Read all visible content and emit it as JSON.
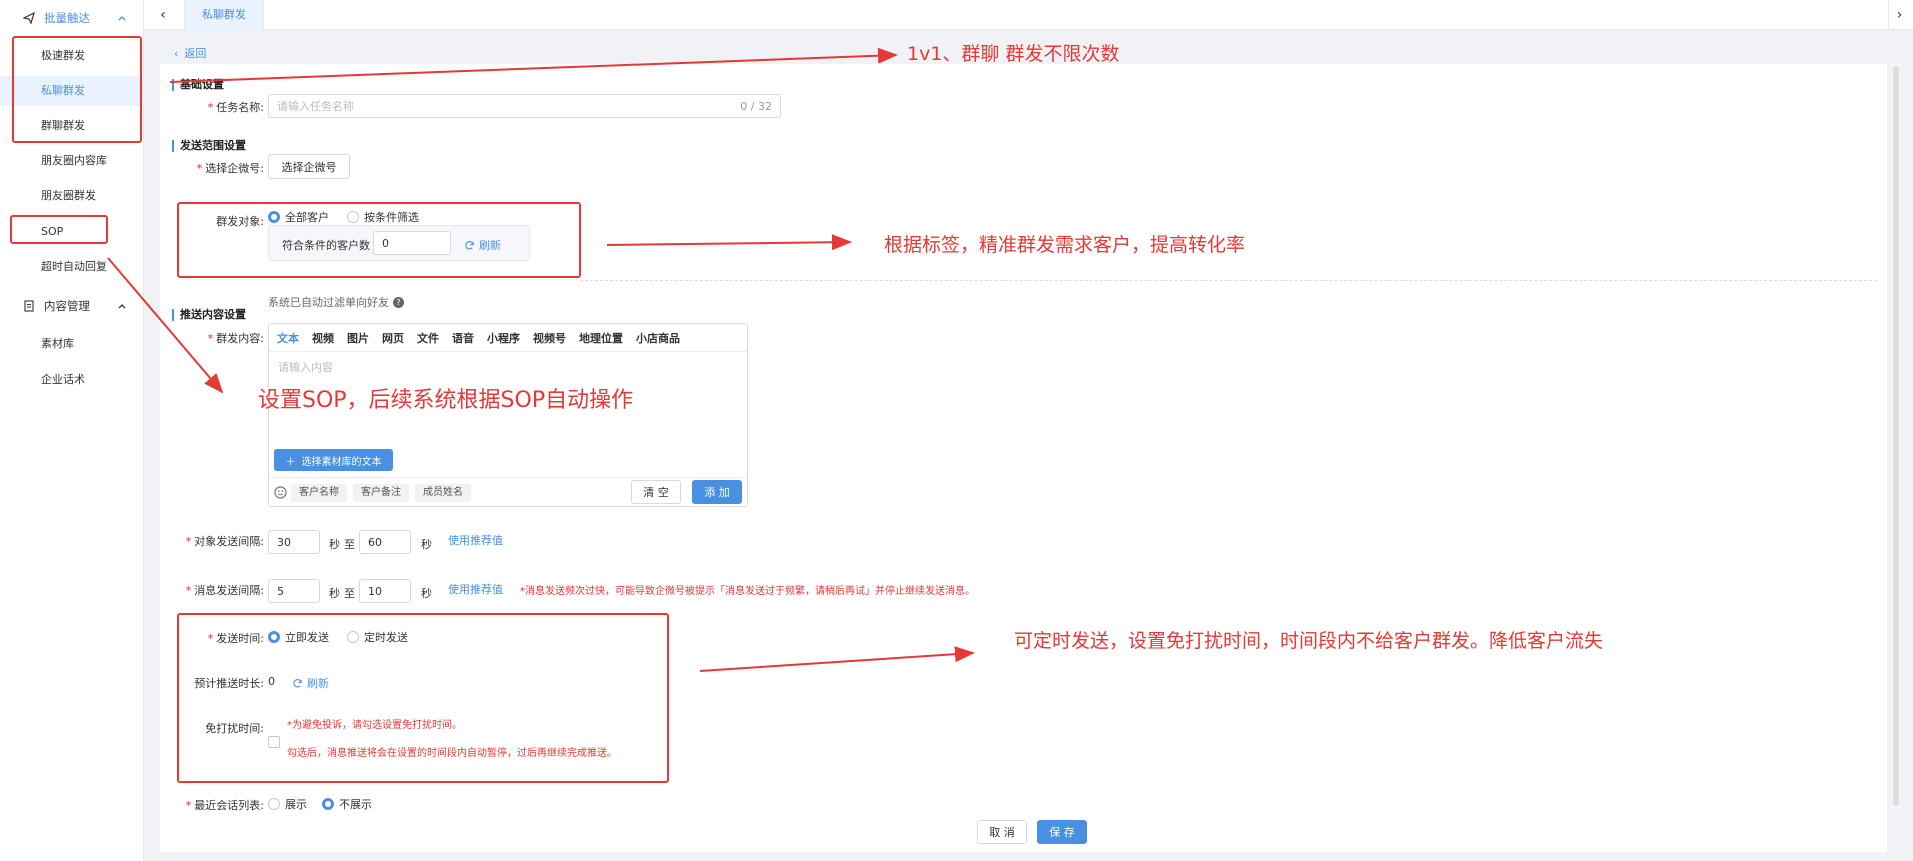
{
  "sidebar": {
    "group1": "批量触达",
    "items": [
      "极速群发",
      "私聊群发",
      "群聊群发",
      "朋友圈内容库",
      "朋友圈群发",
      "SOP",
      "超时自动回复"
    ],
    "group2": "内容管理",
    "items2": [
      "素材库",
      "企业话术"
    ]
  },
  "tabs": {
    "active": "私聊群发"
  },
  "back": "返回",
  "sections": {
    "basic": "基础设置",
    "scope": "发送范围设置",
    "content": "推送内容设置"
  },
  "form": {
    "task_name_label": "任务名称:",
    "task_name_placeholder": "请输入任务名称",
    "task_name_count": "0 / 32",
    "account_label": "选择企微号:",
    "account_button": "选择企微号",
    "target_label": "群发对象:",
    "target_all": "全部客户",
    "target_filter": "按条件筛选",
    "match_label": "符合条件的客户数",
    "match_value": "0",
    "refresh": "刷新",
    "filter_note": "系统已自动过滤单向好友",
    "content_label": "群发内容:",
    "content_tabs": [
      "文本",
      "视频",
      "图片",
      "网页",
      "文件",
      "语音",
      "小程序",
      "视频号",
      "地理位置",
      "小店商品"
    ],
    "content_placeholder": "请输入内容",
    "select_material": "选择素材库的文本",
    "tags": [
      "客户名称",
      "客户备注",
      "成员姓名"
    ],
    "clear": "清 空",
    "add": "添 加",
    "obj_interval_label": "对象发送间隔:",
    "obj_from": "30",
    "obj_to": "60",
    "sec": "秒",
    "to": "至",
    "use_recommend": "使用推荐值",
    "msg_interval_label": "消息发送间隔:",
    "msg_from": "5",
    "msg_to": "10",
    "msg_warning": "*消息发送频次过快，可能导致企微号被提示「消息发送过于频繁，请稍后再试」并停止继续发送消息。",
    "send_time_label": "发送时间:",
    "send_now": "立即发送",
    "send_scheduled": "定时发送",
    "est_label": "预计推送时长:",
    "est_value": "0",
    "dnd_label": "免打扰时间:",
    "dnd_note1": "*为避免投诉，请勾选设置免打扰时间。",
    "dnd_note2": "勾选后，消息推送将会在设置的时间段内自动暂停，过后再继续完成推送。",
    "recent_label": "最近会话列表:",
    "recent_show": "展示",
    "recent_hide": "不展示",
    "cancel": "取 消",
    "save": "保 存"
  },
  "annotations": {
    "a1": "1v1、群聊 群发不限次数",
    "a2": "根据标签，精准群发需求客户，提高转化率",
    "a3": "设置SOP，后续系统根据SOP自动操作",
    "a4": "可定时发送，设置免打扰时间，时间段内不给客户群发。降低客户流失"
  },
  "colors": {
    "accent": "#4a90e2",
    "annotation": "#e53935"
  }
}
